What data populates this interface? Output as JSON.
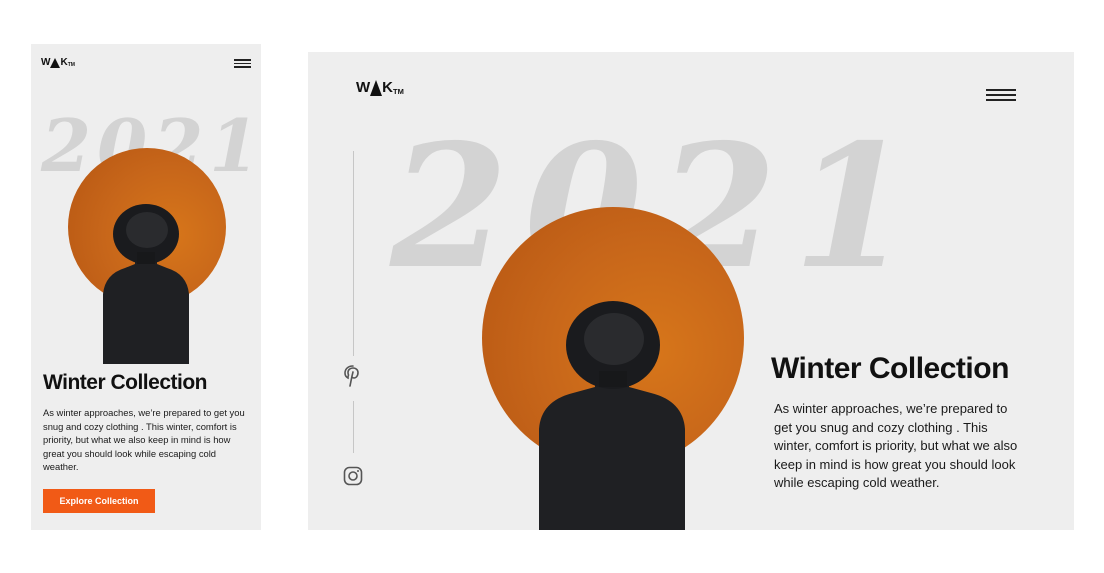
{
  "brand": {
    "logo_pre": "W",
    "logo_post": "K",
    "logo_tm": "TM"
  },
  "hero": {
    "year": "2021",
    "title": "Winter Collection",
    "description": "As winter approaches, we’re prepared to get you snug and cozy clothing . This winter, comfort is priority, but what we also keep in mind is how great you should look while escaping cold weather.",
    "cta_label": "Explore Collection"
  },
  "social": {
    "icons": [
      "pinterest-icon",
      "instagram-icon"
    ]
  },
  "colors": {
    "accent": "#f15a16",
    "sun": "#c7661a",
    "background": "#eeeeee",
    "year": "#d3d3d3"
  }
}
